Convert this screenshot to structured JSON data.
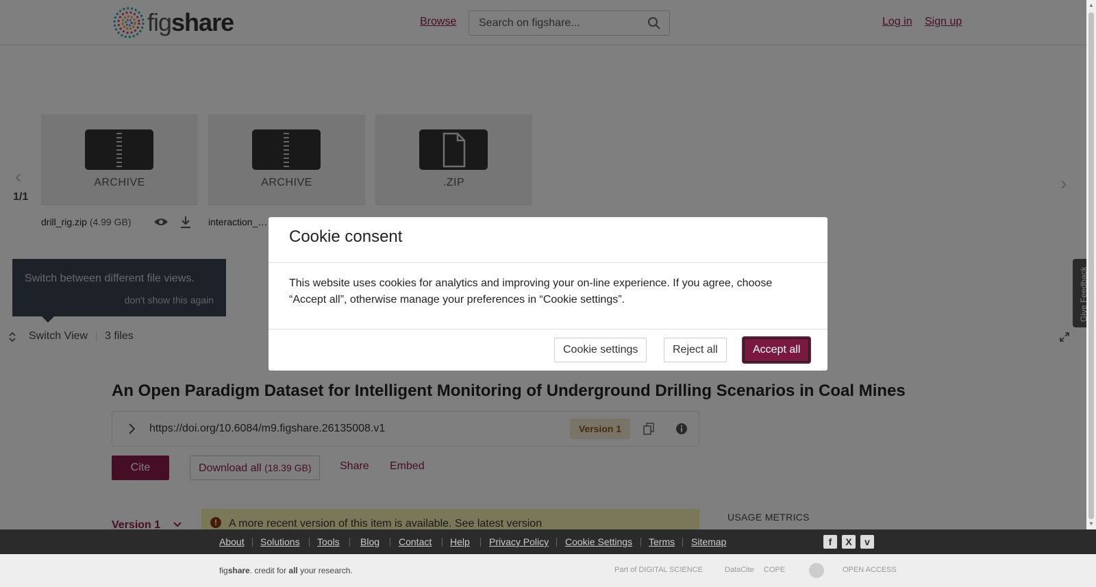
{
  "header": {
    "logo_text": "figshare",
    "browse": "Browse",
    "search_placeholder": "Search on figshare...",
    "login": "Log in",
    "signup": "Sign up"
  },
  "viewer": {
    "pager": "1/1",
    "tiles": [
      {
        "type_label": "ARCHIVE",
        "icon": "zip-archive-icon"
      },
      {
        "type_label": "ARCHIVE",
        "icon": "zip-archive-icon"
      },
      {
        "type_label": ".ZIP",
        "icon": "document-icon"
      }
    ],
    "files": [
      {
        "name": "drill_rig.zip",
        "size": "(4.99 GB)"
      },
      {
        "name": "interaction_…",
        "size": ""
      }
    ],
    "tip": {
      "text": "Switch between different file views.",
      "dismiss": "don't show this again"
    },
    "switch_view": "Switch View",
    "files_count": "3 files",
    "feedback": "Give Feedback"
  },
  "item": {
    "title": "An Open Paradigm Dataset for Intelligent Monitoring of Underground Drilling Scenarios in Coal Mines",
    "doi": "https://doi.org/10.6084/m9.figshare.26135008.v1",
    "version_badge": "Version 1",
    "cite": "Cite",
    "download_all": "Download all",
    "download_size": "(18.39 GB)",
    "share": "Share",
    "embed": "Embed",
    "version_dropdown": "Version 1",
    "notice": "A more recent version of this item is available. See latest version",
    "usage_metrics": "USAGE METRICS"
  },
  "modal": {
    "title": "Cookie consent",
    "body": "This website uses cookies for analytics and improving your on-line experience. If you agree, choose “Accept all”, otherwise manage your preferences in “Cookie settings”.",
    "cookie_settings": "Cookie settings",
    "reject_all": "Reject all",
    "accept_all": "Accept all"
  },
  "footer": {
    "links": [
      "About",
      "Solutions",
      "Tools",
      "Blog",
      "Contact",
      "Help",
      "Privacy Policy",
      "Cookie Settings",
      "Terms",
      "Sitemap"
    ],
    "social": [
      "f",
      "X",
      "v"
    ],
    "credit_pre": "fig",
    "credit_bold": "share",
    "credit_mid": ". credit for ",
    "credit_all": "all",
    "credit_post": " your research.",
    "partners": [
      "Part of DIGITAL SCIENCE",
      "DataCite",
      "COPE",
      "",
      "OPEN ACCESS"
    ]
  },
  "colors": {
    "brand": "#8a1c4b",
    "footer": "#2b2b2b",
    "notice": "#f7f0b5"
  }
}
